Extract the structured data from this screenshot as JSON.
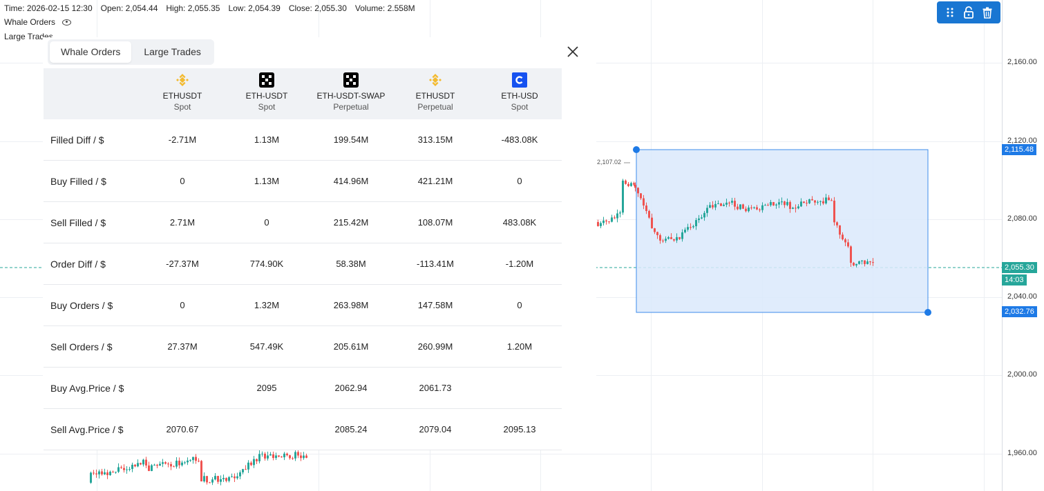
{
  "info_bar": {
    "time": "Time: 2026-02-15 12:30",
    "open": "Open: 2,054.44",
    "high": "High: 2,055.35",
    "low": "Low: 2,054.39",
    "close": "Close: 2,055.30",
    "volume": "Volume: 2.558M"
  },
  "legend": {
    "whale_orders": "Whale Orders",
    "large_trades": "Large Trades"
  },
  "price_axis": {
    "ticks": [
      "2,160.00",
      "2,120.00",
      "2,080.00",
      "2,040.00",
      "2,000.00",
      "1,960.00"
    ],
    "box_top": "2,115.48",
    "current_price": "2,055.30",
    "countdown": "14:03",
    "box_bottom": "2,032.76",
    "high_marker": "2,107.02"
  },
  "colors": {
    "up": "#26a69a",
    "down": "#ef5350",
    "accent": "#1976d2",
    "box_fill": "#dbe9fb",
    "binance": "#f3ba2f"
  },
  "panel": {
    "tabs": [
      {
        "label": "Whale Orders",
        "active": true
      },
      {
        "label": "Large Trades",
        "active": false
      }
    ],
    "columns": [
      {
        "symbol": "ETHUSDT",
        "market": "Spot",
        "icon": "binance-logo"
      },
      {
        "symbol": "ETH-USDT",
        "market": "Spot",
        "icon": "okx-logo"
      },
      {
        "symbol": "ETH-USDT-SWAP",
        "market": "Perpetual",
        "icon": "okx-logo"
      },
      {
        "symbol": "ETHUSDT",
        "market": "Perpetual",
        "icon": "binance-logo"
      },
      {
        "symbol": "ETH-USD",
        "market": "Spot",
        "icon": "coinbase-logo"
      }
    ],
    "rows": [
      {
        "label": "Filled Diff / $",
        "cells": [
          "-2.71M",
          "1.13M",
          "199.54M",
          "313.15M",
          "-483.08K"
        ],
        "tones": [
          "neg",
          "pos",
          "pos",
          "pos",
          "neg"
        ]
      },
      {
        "label": "Buy Filled / $",
        "cells": [
          "0",
          "1.13M",
          "414.96M",
          "421.21M",
          "0"
        ],
        "tones": [
          "",
          "",
          "",
          "",
          ""
        ]
      },
      {
        "label": "Sell Filled / $",
        "cells": [
          "2.71M",
          "0",
          "215.42M",
          "108.07M",
          "483.08K"
        ],
        "tones": [
          "",
          "",
          "",
          "",
          ""
        ]
      },
      {
        "label": "Order Diff / $",
        "cells": [
          "-27.37M",
          "774.90K",
          "58.38M",
          "-113.41M",
          "-1.20M"
        ],
        "tones": [
          "",
          "",
          "",
          "",
          ""
        ]
      },
      {
        "label": "Buy Orders / $",
        "cells": [
          "0",
          "1.32M",
          "263.98M",
          "147.58M",
          "0"
        ],
        "tones": [
          "",
          "",
          "",
          "",
          ""
        ]
      },
      {
        "label": "Sell Orders / $",
        "cells": [
          "27.37M",
          "547.49K",
          "205.61M",
          "260.99M",
          "1.20M"
        ],
        "tones": [
          "",
          "",
          "",
          "",
          ""
        ]
      },
      {
        "label": "Buy Avg.Price / $",
        "cells": [
          "",
          "2095",
          "2062.94",
          "2061.73",
          ""
        ],
        "tones": [
          "",
          "pos",
          "pos",
          "pos",
          ""
        ]
      },
      {
        "label": "Sell Avg.Price / $",
        "cells": [
          "2070.67",
          "",
          "2085.24",
          "2079.04",
          "2095.13"
        ],
        "tones": [
          "neg",
          "",
          "",
          "",
          "neg"
        ]
      }
    ]
  }
}
